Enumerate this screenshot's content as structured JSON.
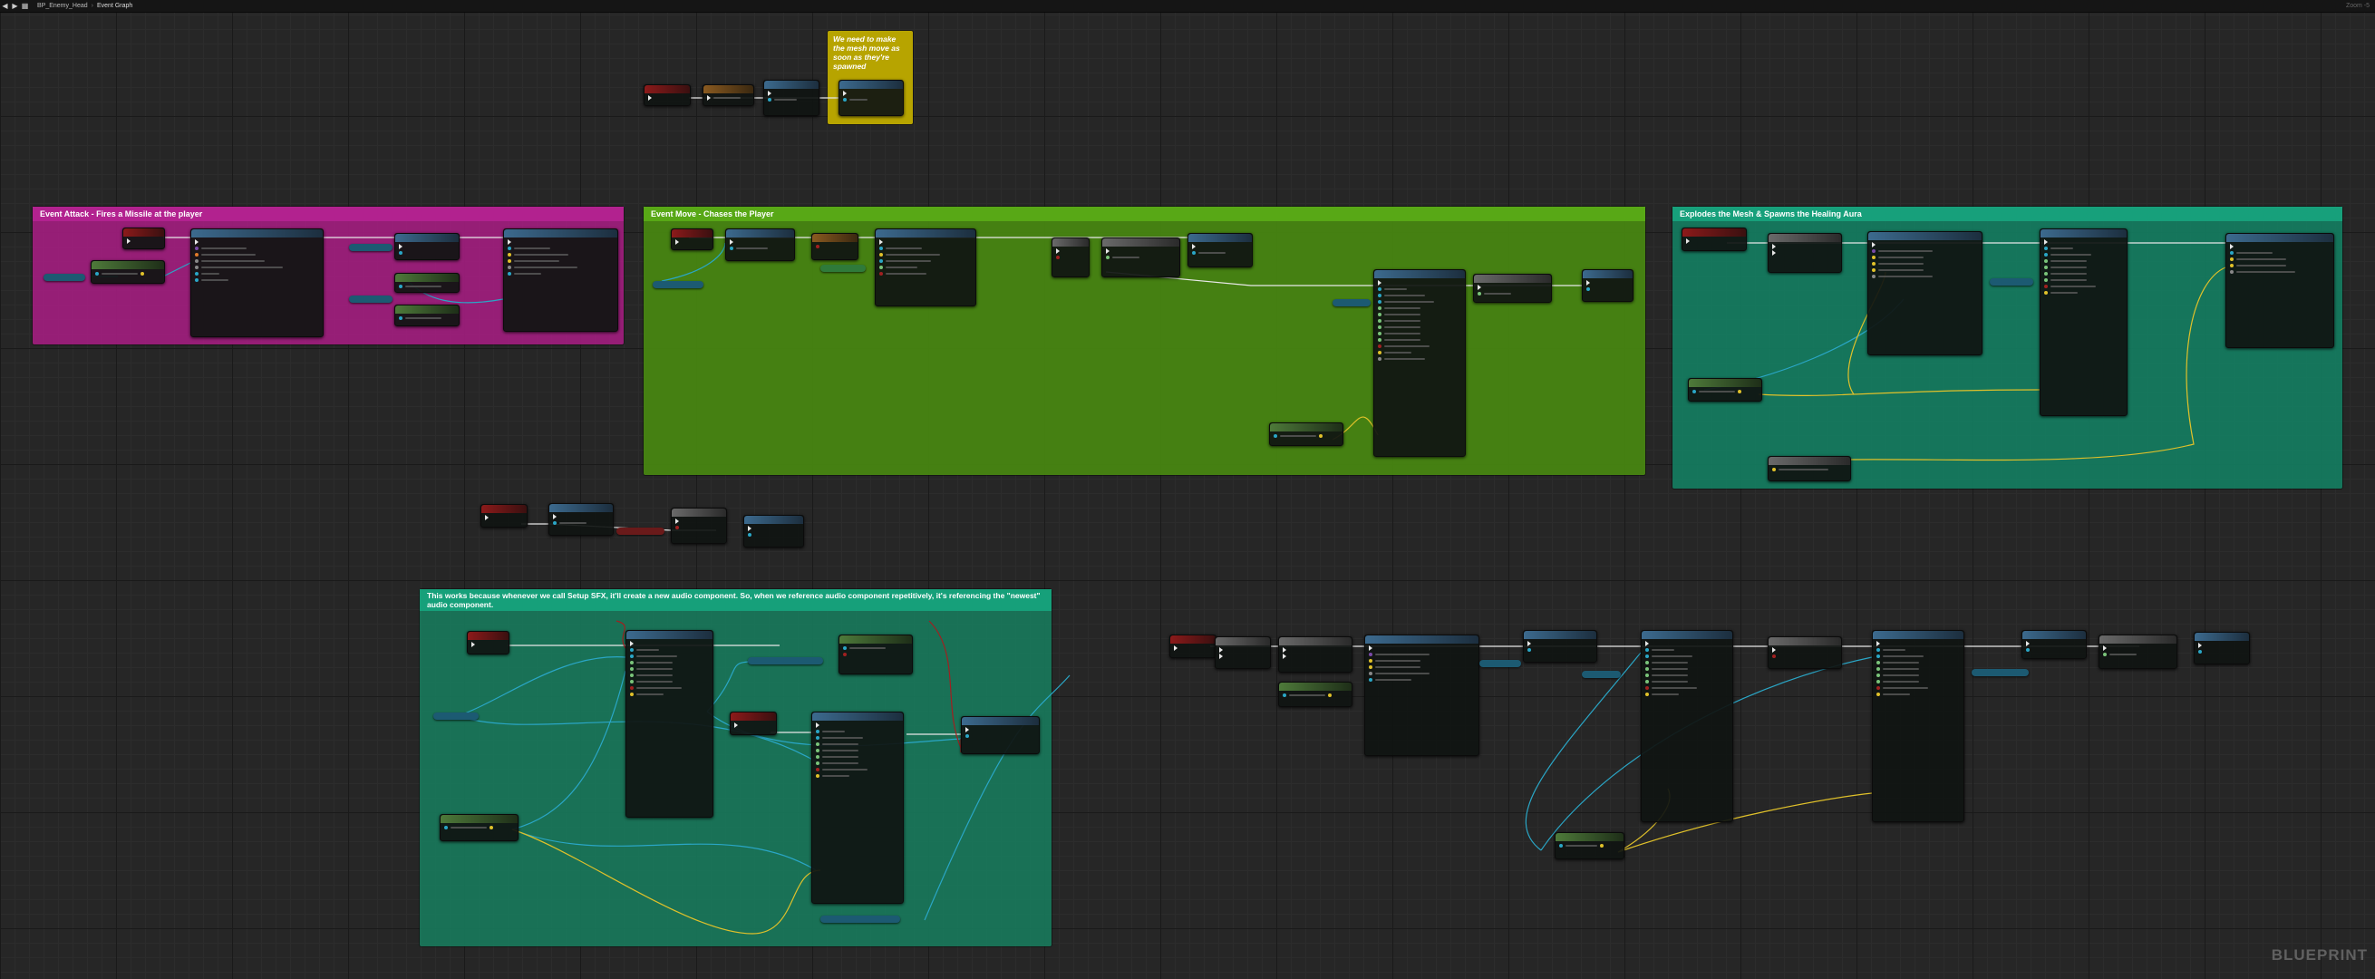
{
  "toolbar": {
    "breadcrumb_1": "BP_Enemy_Head",
    "breadcrumb_2": "Event Graph",
    "zoom": "Zoom -5"
  },
  "comments": {
    "attack": "Event Attack - Fires a Missile at the player",
    "move": "Event Move - Chases the Player",
    "explode": "Explodes the Mesh & Spawns the Healing Aura",
    "audio": "This works because whenever we call Setup SFX, it'll create a new audio component. So, when we reference audio component repetitively, it's referencing the \"newest\" audio component.",
    "note": "We need to make the mesh move as soon as they're spawned"
  },
  "watermark": "BLUEPRINT",
  "colors": {
    "exec": "#e8e8e8",
    "object_wire": "#2aa6c6",
    "vector_wire": "#e0c12a",
    "bool_wire": "#8c1f1f",
    "magenta_comment": "#b2228f",
    "green_comment": "#58a816",
    "teal_comment": "#17a07b",
    "yellow_comment": "#b7a400"
  }
}
